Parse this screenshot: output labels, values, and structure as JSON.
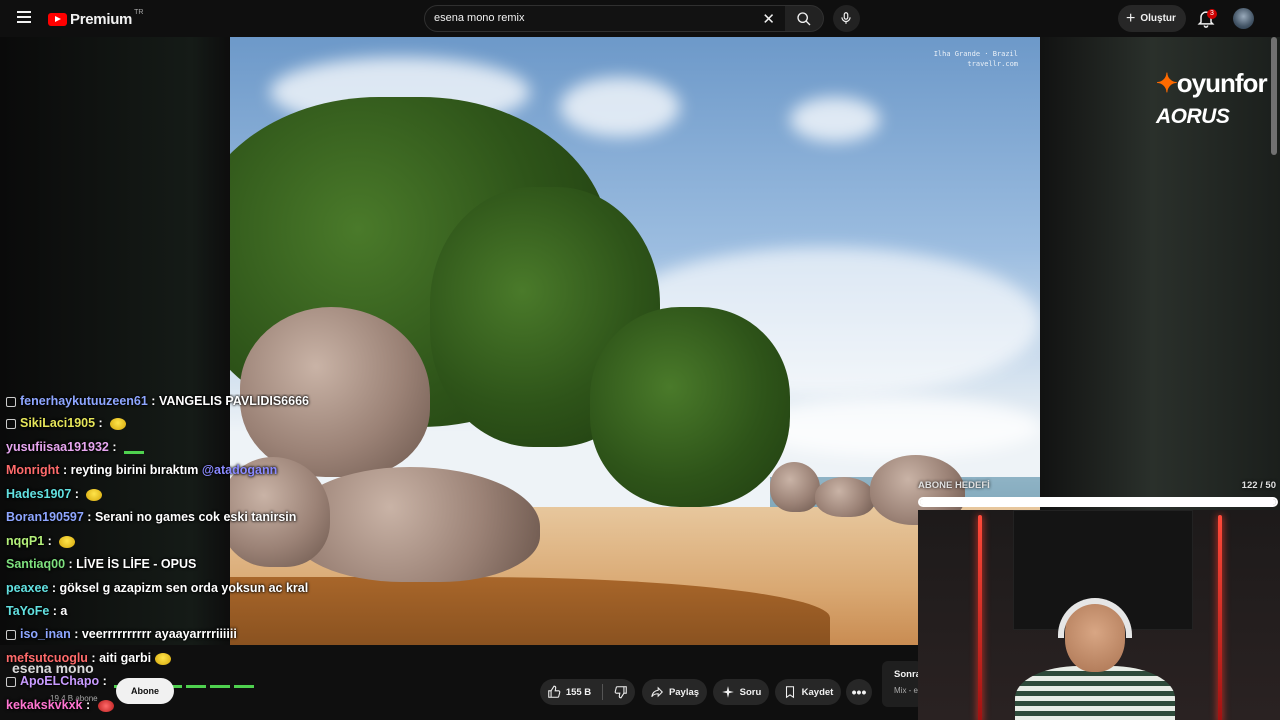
{
  "header": {
    "logo_text": "Premium",
    "logo_region": "TR",
    "search_value": "esena mono remix",
    "create_label": "Oluştur",
    "notification_count": "3"
  },
  "video": {
    "watermark_line1": "Ilha Grande · Brazil",
    "watermark_line2": "travellr.com"
  },
  "overlay": {
    "brand_oyunfor": "oyunfor",
    "brand_aorus": "AORUS",
    "goal_label": "ABONE HEDEFİ",
    "goal_count": "122 / 50",
    "goal_progress": 1.0
  },
  "chat": [
    {
      "user": "fenerhaykutuuzeen61",
      "message": "VANGELIS PAVLIDIS6666",
      "color": "u-blue",
      "icon": true,
      "emote": ""
    },
    {
      "user": "SikiLaci1905",
      "message": "",
      "color": "u-yellow",
      "icon": true,
      "emote": "yellow"
    },
    {
      "user": "yusufiisaa191932",
      "message": "",
      "color": "u-pink",
      "icon": false,
      "emote": "green"
    },
    {
      "user": "Monright",
      "message": "reyting birini bıraktım",
      "mention": "@atadogann",
      "color": "u-red",
      "icon": false,
      "emote": ""
    },
    {
      "user": "Hades1907",
      "message": "",
      "color": "u-cyan",
      "icon": false,
      "emote": "yellow"
    },
    {
      "user": "Boran190597",
      "message": "Serani no games cok eski tanirsin",
      "color": "u-blue",
      "icon": false,
      "emote": ""
    },
    {
      "user": "nqqP1",
      "message": "",
      "color": "u-lime",
      "icon": false,
      "emote": "yellow"
    },
    {
      "user": "Santiaq00",
      "message": "LİVE İS LİFE - OPUS",
      "color": "u-green",
      "icon": false,
      "emote": ""
    },
    {
      "user": "peaxee",
      "message": "göksel g azapizm sen orda yoksun ac kral",
      "color": "u-cyan",
      "icon": false,
      "emote": ""
    },
    {
      "user": "TaYoFe",
      "message": "a",
      "color": "u-cyan",
      "icon": false,
      "emote": ""
    },
    {
      "user": "iso_inan",
      "message": "veerrrrrrrrrr ayaayarrrriiiiii",
      "color": "u-blue",
      "icon": true,
      "emote": ""
    },
    {
      "user": "mefsutcuoglu",
      "message": "aiti garbi",
      "color": "u-red",
      "icon": false,
      "emote": "yellow"
    },
    {
      "user": "ApoELChapo",
      "message": "",
      "color": "u-purple",
      "icon": true,
      "emote": "green"
    },
    {
      "user": "kekakskvkxk",
      "message": "",
      "color": "u-magenta",
      "icon": false,
      "emote": "red"
    }
  ],
  "channel": {
    "name": "esena mono",
    "subscribers": "19,4 B abone",
    "subscribe_label": "Abone"
  },
  "actions": {
    "like_count": "155 B",
    "share_label": "Paylaş",
    "ask_label": "Soru",
    "save_label": "Kaydet"
  },
  "next": {
    "title": "Sonra",
    "subtitle": "Mix - e"
  },
  "colors": {
    "accent_red": "#ff0000",
    "background": "#0f0f0f",
    "pill": "#272727"
  }
}
